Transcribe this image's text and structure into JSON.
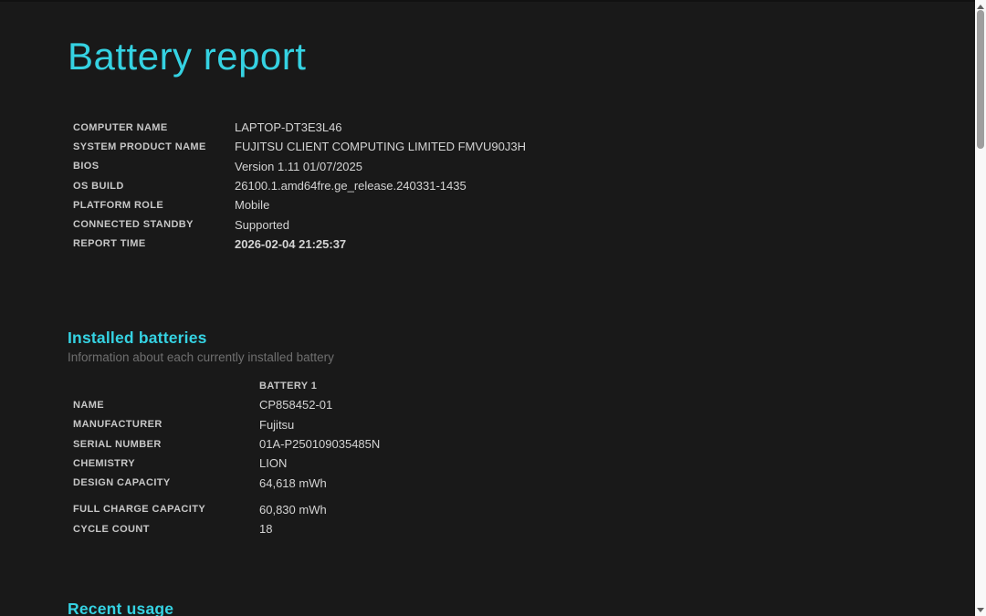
{
  "colors": {
    "accent": "#35d2e2",
    "background": "#191919",
    "label_text": "#c7c7c7",
    "value_text": "#d4d4d4",
    "muted_text": "#6f6f6f",
    "scrollbar_track": "#f8f8f8",
    "scrollbar_thumb": "#9e9e9e"
  },
  "title": "Battery report",
  "system_info": {
    "rows": [
      {
        "label": "COMPUTER NAME",
        "value": "LAPTOP-DT3E3L46"
      },
      {
        "label": "SYSTEM PRODUCT NAME",
        "value": "FUJITSU CLIENT COMPUTING LIMITED FMVU90J3H"
      },
      {
        "label": "BIOS",
        "value": "Version 1.11 01/07/2025"
      },
      {
        "label": "OS BUILD",
        "value": "26100.1.amd64fre.ge_release.240331-1435"
      },
      {
        "label": "PLATFORM ROLE",
        "value": "Mobile"
      },
      {
        "label": "CONNECTED STANDBY",
        "value": "Supported"
      },
      {
        "label": "REPORT TIME",
        "value": "2026-02-04 21:25:37"
      }
    ]
  },
  "installed_batteries": {
    "heading": "Installed batteries",
    "subtitle": "Information about each currently installed battery",
    "column_header": "BATTERY 1",
    "rows": [
      {
        "label": "NAME",
        "value": "CP858452-01"
      },
      {
        "label": "MANUFACTURER",
        "value": "Fujitsu"
      },
      {
        "label": "SERIAL NUMBER",
        "value": "01A-P250109035485N"
      },
      {
        "label": "CHEMISTRY",
        "value": "LION"
      },
      {
        "label": "DESIGN CAPACITY",
        "value": "64,618 mWh"
      },
      {
        "label": "FULL CHARGE CAPACITY",
        "value": "60,830 mWh"
      },
      {
        "label": "CYCLE COUNT",
        "value": "18"
      }
    ]
  },
  "recent_usage": {
    "heading": "Recent usage"
  },
  "scrollbar": {
    "up_icon": "scrollbar-up-arrow",
    "down_icon": "scrollbar-down-arrow"
  }
}
